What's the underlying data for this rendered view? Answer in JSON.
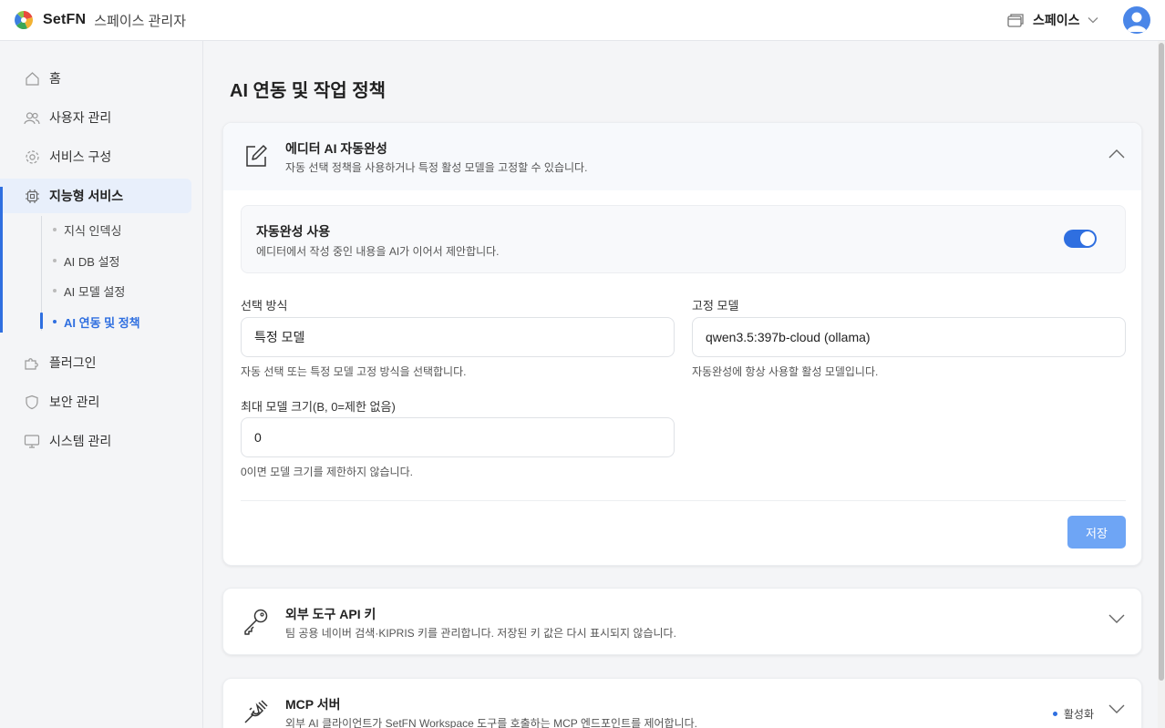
{
  "header": {
    "brand": "SetFN",
    "subtitle": "스페이스 관리자",
    "space_label": "스페이스"
  },
  "sidebar": {
    "items": [
      {
        "label": "홈",
        "icon": "home-icon"
      },
      {
        "label": "사용자 관리",
        "icon": "users-icon"
      },
      {
        "label": "서비스 구성",
        "icon": "gear-icon"
      },
      {
        "label": "지능형 서비스",
        "icon": "chip-icon",
        "active": true
      },
      {
        "label": "플러그인",
        "icon": "puzzle-icon"
      },
      {
        "label": "보안 관리",
        "icon": "shield-icon"
      },
      {
        "label": "시스템 관리",
        "icon": "monitor-icon"
      }
    ],
    "subitems": [
      {
        "label": "지식 인덱싱"
      },
      {
        "label": "AI DB 설정"
      },
      {
        "label": "AI 모델 설정"
      },
      {
        "label": "AI 연동 및 정책",
        "active": true
      }
    ]
  },
  "main": {
    "title": "AI 연동 및 작업 정책",
    "autocomplete": {
      "title": "에디터 AI 자동완성",
      "desc": "자동 선택 정책을 사용하거나 특정 활성 모델을 고정할 수 있습니다.",
      "enable_title": "자동완성 사용",
      "enable_desc": "에디터에서 작성 중인 내용을 AI가 이어서 제안합니다.",
      "enabled": true,
      "select_mode_label": "선택 방식",
      "select_mode_value": "특정 모델",
      "select_mode_hint": "자동 선택 또는 특정 모델 고정 방식을 선택합니다.",
      "fixed_model_label": "고정 모델",
      "fixed_model_value": "qwen3.5:397b-cloud (ollama)",
      "fixed_model_hint": "자동완성에 항상 사용할 활성 모델입니다.",
      "max_size_label": "최대 모델 크기(B, 0=제한 없음)",
      "max_size_value": "0",
      "max_size_hint": "0이면 모델 크기를 제한하지 않습니다.",
      "save_label": "저장"
    },
    "api_keys": {
      "title": "외부 도구 API 키",
      "desc": "팀 공용 네이버 검색·KIPRIS 키를 관리합니다. 저장된 키 값은 다시 표시되지 않습니다."
    },
    "mcp": {
      "title": "MCP 서버",
      "desc": "외부 AI 클라이언트가 SetFN Workspace 도구를 호출하는 MCP 엔드포인트를 제어합니다.",
      "status": "활성화"
    }
  },
  "colors": {
    "accent": "#2f6fe0",
    "save_button": "#6ea5f5"
  }
}
